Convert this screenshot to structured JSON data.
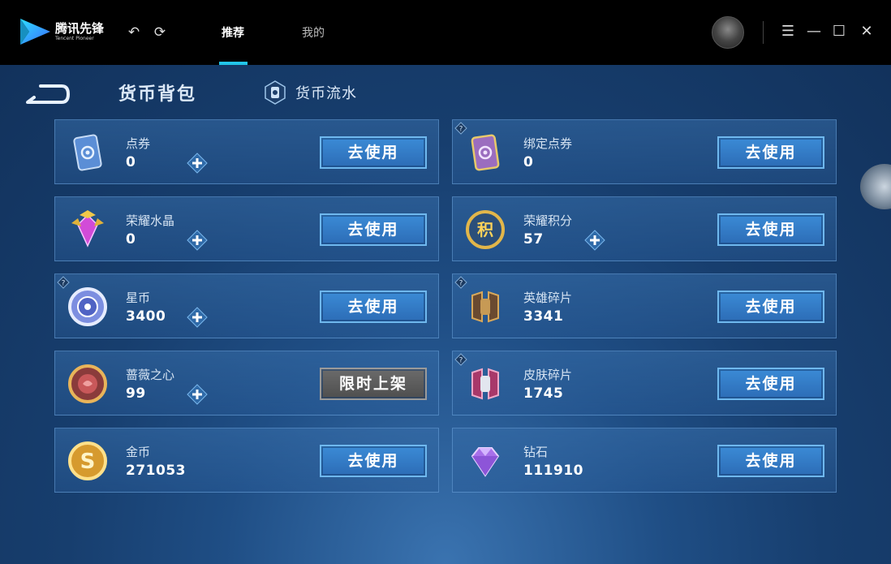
{
  "app": {
    "logo_cn": "腾讯先锋",
    "logo_en": "Tencent Pioneer",
    "tabs": [
      {
        "label": "推荐",
        "active": true
      },
      {
        "label": "我的",
        "active": false
      }
    ]
  },
  "page": {
    "title": "货币背包",
    "flow_link": "货币流水"
  },
  "currencies": [
    {
      "name": "点券",
      "value": "0",
      "button": "去使用",
      "icon": "coupon-icon",
      "has_plus": true,
      "help": false
    },
    {
      "name": "绑定点券",
      "value": "0",
      "button": "去使用",
      "icon": "bound-coupon-icon",
      "has_plus": false,
      "help": true
    },
    {
      "name": "荣耀水晶",
      "value": "0",
      "button": "去使用",
      "icon": "glory-crystal-icon",
      "has_plus": true,
      "help": false
    },
    {
      "name": "荣耀积分",
      "value": "57",
      "button": "去使用",
      "icon": "glory-points-icon",
      "has_plus": true,
      "help": false
    },
    {
      "name": "星币",
      "value": "3400",
      "button": "去使用",
      "icon": "star-coin-icon",
      "has_plus": true,
      "help": true
    },
    {
      "name": "英雄碎片",
      "value": "3341",
      "button": "去使用",
      "icon": "hero-fragment-icon",
      "has_plus": false,
      "help": true
    },
    {
      "name": "蔷薇之心",
      "value": "99",
      "button": "限时上架",
      "icon": "rose-heart-icon",
      "has_plus": true,
      "help": false,
      "disabled": true
    },
    {
      "name": "皮肤碎片",
      "value": "1745",
      "button": "去使用",
      "icon": "skin-fragment-icon",
      "has_plus": false,
      "help": true
    },
    {
      "name": "金币",
      "value": "271053",
      "button": "去使用",
      "icon": "gold-coin-icon",
      "has_plus": false,
      "help": false
    },
    {
      "name": "钻石",
      "value": "111910",
      "button": "去使用",
      "icon": "diamond-icon",
      "has_plus": false,
      "help": false
    }
  ],
  "colors": {
    "accent": "#22c4e8",
    "button_blue": "#2c6cb6",
    "button_gray": "#4e4e4e"
  }
}
